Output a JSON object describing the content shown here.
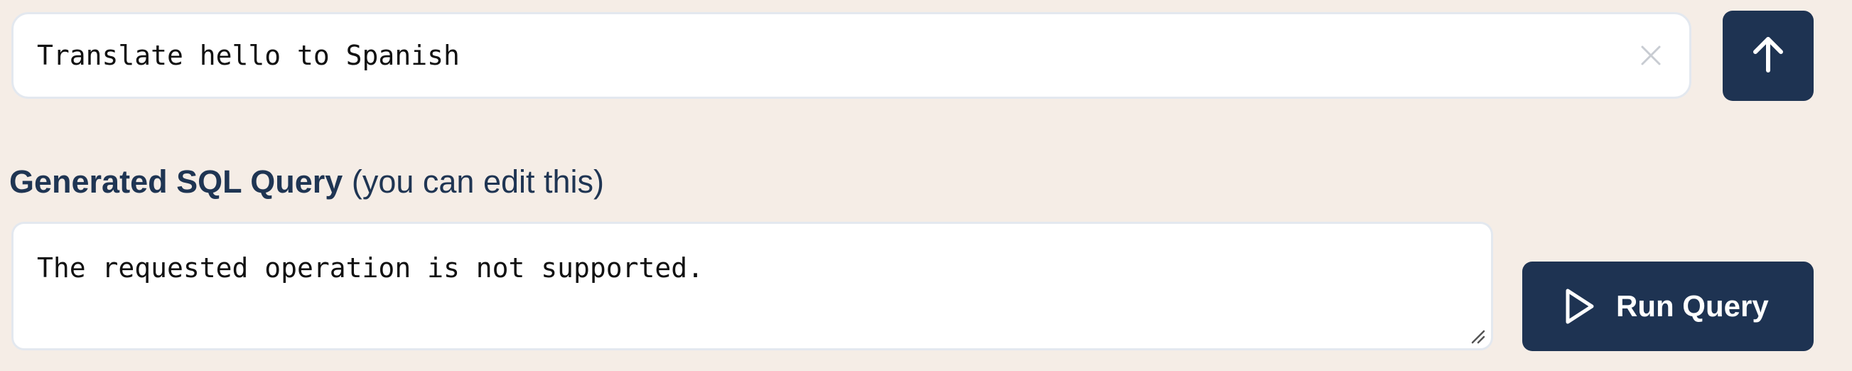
{
  "prompt": {
    "value": "Translate hello to Spanish",
    "clear_icon": "close-icon"
  },
  "submit": {
    "icon": "arrow-up-icon"
  },
  "sql_section": {
    "label_main": "Generated SQL Query",
    "label_hint": "(you can edit this)",
    "query_text": "The requested operation is not supported.",
    "resize_icon": "resize-handle-icon"
  },
  "run_button": {
    "icon": "play-icon",
    "label": "Run Query"
  },
  "colors": {
    "background": "#f5ede6",
    "primary_button": "#1e3352",
    "label_text": "#1f3553",
    "input_border": "#e3e8ef"
  }
}
